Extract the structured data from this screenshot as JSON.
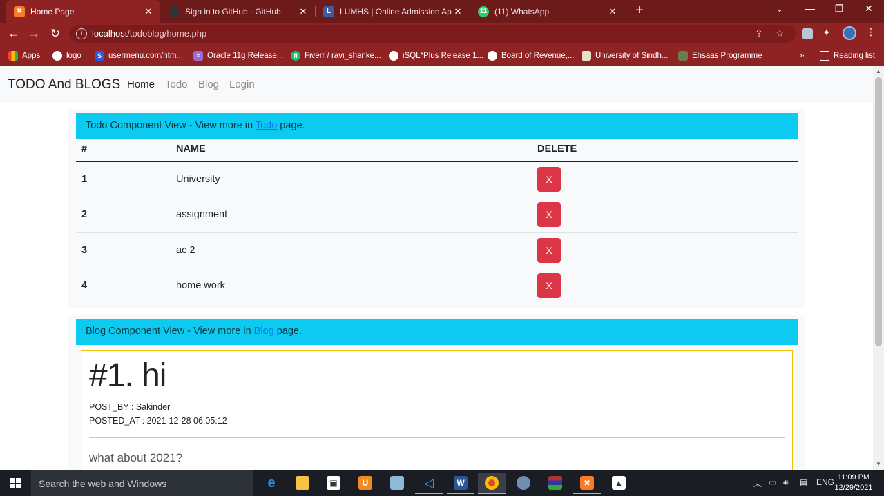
{
  "browser": {
    "tabs": [
      {
        "title": "Home Page",
        "active": true,
        "favicon": "xampp-icon",
        "color": "#fb7a24"
      },
      {
        "title": "Sign in to GitHub · GitHub",
        "active": false,
        "favicon": "github-icon",
        "color": "#333333"
      },
      {
        "title": "LUMHS | Online Admission Appli",
        "active": false,
        "favicon": "lumhs-icon",
        "color": "#3b5ba8"
      },
      {
        "title": "(11) WhatsApp",
        "active": false,
        "favicon": "whatsapp-icon",
        "color": "#25d366",
        "badge": "11"
      }
    ],
    "address": {
      "host": "localhost",
      "path": "/todoblog/home.php"
    },
    "bookmarks": [
      {
        "label": "Apps",
        "icon": "apps-grid-icon"
      },
      {
        "label": "logo",
        "icon": "globe-icon"
      },
      {
        "label": "usermenu.com/htm...",
        "icon": "s-icon"
      },
      {
        "label": "Oracle 11g Release...",
        "icon": "oracle-icon"
      },
      {
        "label": "Fiverr / ravi_shanke...",
        "icon": "fiverr-icon"
      },
      {
        "label": "iSQL*Plus Release 1...",
        "icon": "globe-icon"
      },
      {
        "label": "Board of Revenue,...",
        "icon": "globe-icon"
      },
      {
        "label": "University of Sindh...",
        "icon": "university-icon"
      },
      {
        "label": "Ehsaas Programme",
        "icon": "ehsaas-icon"
      }
    ],
    "more_label": "»",
    "reading_list": "Reading list"
  },
  "site": {
    "brand": "TODO And BLOGS",
    "nav": [
      "Home",
      "Todo",
      "Blog",
      "Login"
    ]
  },
  "todo": {
    "alert_prefix": "Todo Component View - View more in ",
    "alert_link": "Todo",
    "alert_suffix": " page.",
    "headers": [
      "#",
      "NAME",
      "DELETE"
    ],
    "rows": [
      {
        "num": "1",
        "name": "University"
      },
      {
        "num": "2",
        "name": "assignment"
      },
      {
        "num": "3",
        "name": "ac 2"
      },
      {
        "num": "4",
        "name": "home work"
      }
    ],
    "delete_label": "X"
  },
  "blog": {
    "alert_prefix": "Blog Component View - View more in ",
    "alert_link": "Blog",
    "alert_suffix": " page.",
    "post": {
      "title": "#1. hi",
      "post_by": "POST_BY : Sakinder",
      "posted_at": "POSTED_AT : 2021-12-28 06:05:12",
      "content": "what about 2021?"
    }
  },
  "taskbar": {
    "search_placeholder": "Search the web and Windows",
    "lang": "ENG",
    "time": "11:09 PM",
    "date": "12/29/2021"
  }
}
